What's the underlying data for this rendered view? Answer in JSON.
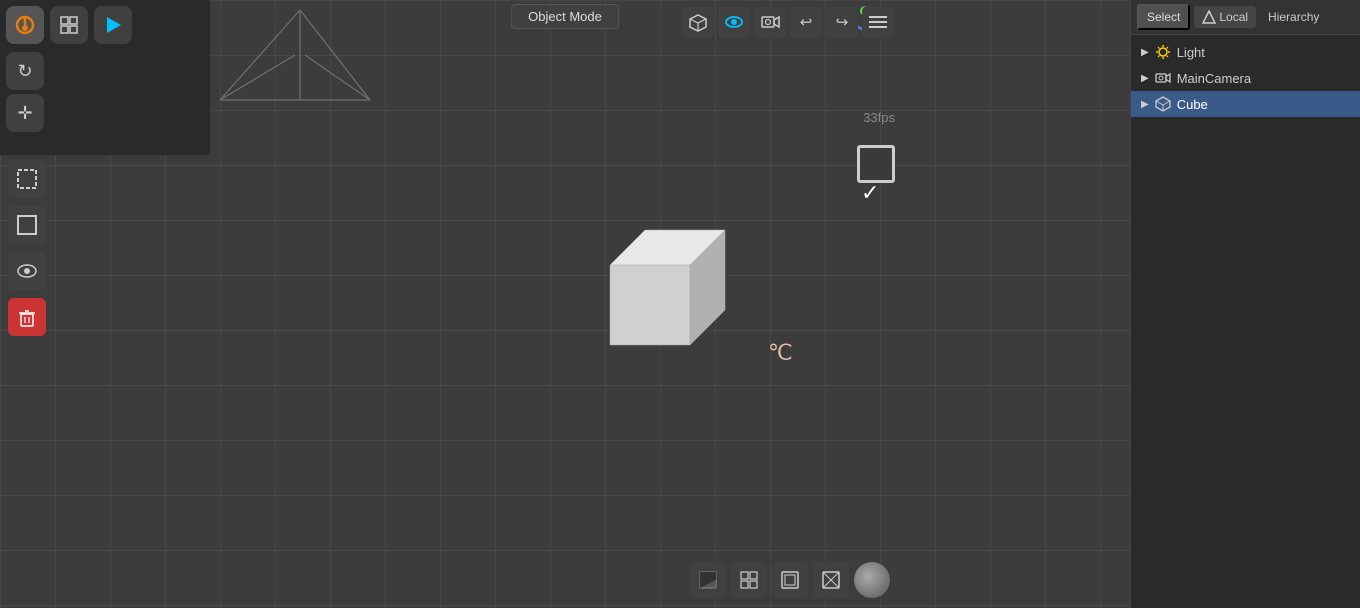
{
  "header": {
    "object_mode": "Object Mode"
  },
  "top_left_toolbar": {
    "icons": [
      {
        "name": "blender-logo",
        "symbol": "⬡",
        "active": true
      },
      {
        "name": "view-layout",
        "symbol": "◻",
        "active": false
      },
      {
        "name": "play",
        "symbol": "▶",
        "active": false
      },
      {
        "name": "refresh",
        "symbol": "↻",
        "active": false
      },
      {
        "name": "move",
        "symbol": "✛",
        "active": false
      }
    ]
  },
  "left_sidebar": {
    "icons": [
      {
        "name": "select-box",
        "symbol": "⬜",
        "active": false
      },
      {
        "name": "select-circle",
        "symbol": "◻",
        "active": false
      },
      {
        "name": "viewport-shade",
        "symbol": "◉",
        "active": false
      },
      {
        "name": "delete",
        "symbol": "🗑",
        "active": false,
        "variant": "delete"
      }
    ]
  },
  "top_right_controls": {
    "icons": [
      {
        "name": "axis-gizmo",
        "symbol": "⊹"
      },
      {
        "name": "view-persp",
        "symbol": "◻"
      },
      {
        "name": "render-mode",
        "symbol": "👁"
      },
      {
        "name": "camera-view",
        "symbol": "📷"
      },
      {
        "name": "undo",
        "symbol": "↩"
      },
      {
        "name": "redo",
        "symbol": "↪"
      },
      {
        "name": "menu",
        "symbol": "☰"
      }
    ]
  },
  "right_panel": {
    "top_buttons": [
      {
        "label": "Select",
        "active": false
      },
      {
        "label": "Local",
        "active": false,
        "has_icon": true
      },
      {
        "label": "Hierarchy",
        "active": false
      }
    ],
    "hierarchy": {
      "title": "Hierarchy",
      "items": [
        {
          "name": "Light",
          "icon": "▶",
          "type": "light"
        },
        {
          "name": "MainCamera",
          "icon": "▶",
          "type": "camera"
        },
        {
          "name": "Cube",
          "icon": "▶",
          "type": "cube",
          "selected": true
        }
      ]
    }
  },
  "bottom_right_icons": [
    {
      "name": "textured-view",
      "symbol": "◼"
    },
    {
      "name": "grid-view",
      "symbol": "⊞"
    },
    {
      "name": "solid-view",
      "symbol": "❏"
    },
    {
      "name": "wireframe-view",
      "symbol": "❐"
    },
    {
      "name": "material-ball",
      "symbol": "●"
    }
  ],
  "fps": "33fps",
  "colors": {
    "bg": "#3c3c3c",
    "panel": "#2a2a2a",
    "accent_blue": "#00bfff",
    "selected_bg": "#3a5a8a",
    "delete_red": "#cc3333"
  }
}
